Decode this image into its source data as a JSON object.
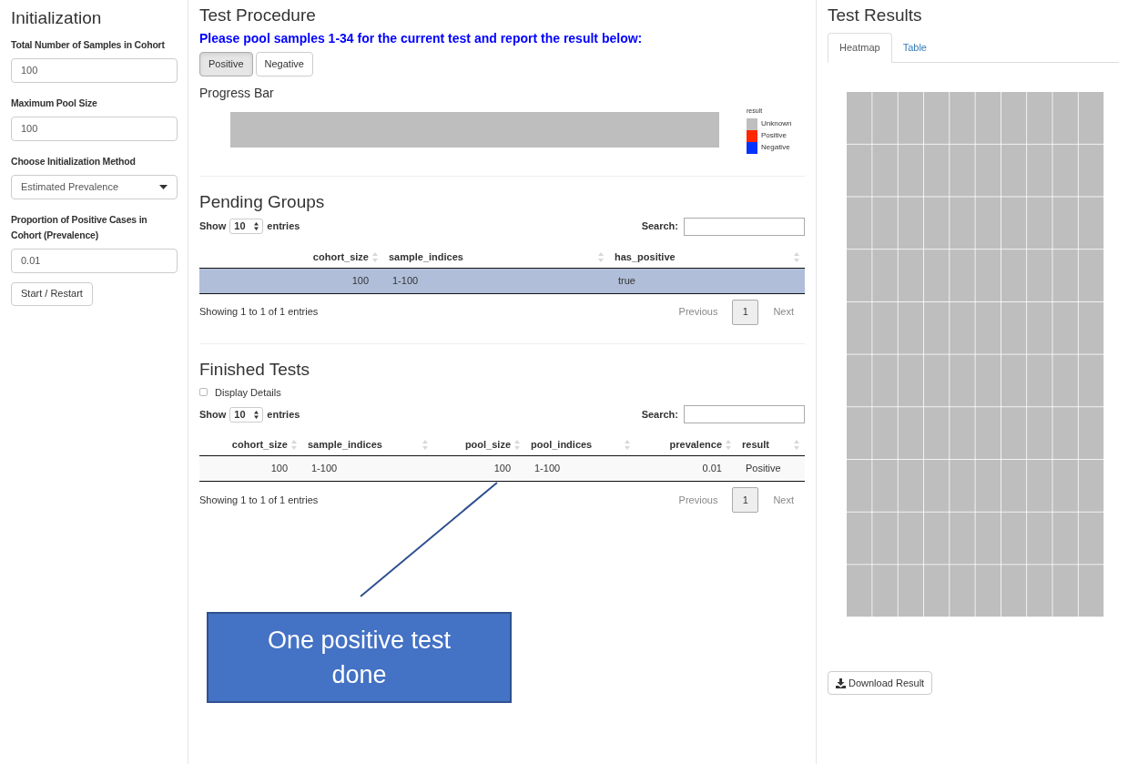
{
  "init": {
    "title": "Initialization",
    "fields": [
      {
        "kind": "input",
        "label": "Total Number of Samples in Cohort",
        "value": "100"
      },
      {
        "kind": "input",
        "label": "Maximum Pool Size",
        "value": "100"
      },
      {
        "kind": "select",
        "label": "Choose Initialization Method",
        "value": "Estimated Prevalence"
      },
      {
        "kind": "input",
        "label": "Proportion of Positive Cases in Cohort (Prevalence)",
        "value": "0.01"
      }
    ],
    "button": "Start / Restart"
  },
  "procedure": {
    "title": "Test Procedure",
    "instruction": "Please pool samples 1-34 for the current test and report the result below:",
    "buttons": [
      {
        "label": "Positive",
        "selected": true
      },
      {
        "label": "Negative",
        "selected": false
      }
    ],
    "progress_title": "Progress Bar",
    "progress": {
      "level": 1
    },
    "legend": {
      "title": "result",
      "items": [
        {
          "label": "Unknown",
          "color": "#bebebe"
        },
        {
          "label": "Positive",
          "color": "#ff2600"
        },
        {
          "label": "Negative",
          "color": "#0433ff"
        }
      ]
    }
  },
  "tables": [
    {
      "title": "Pending Groups",
      "show": "Show",
      "length": "10",
      "entries": "entries",
      "search": "Search:",
      "columns": [
        {
          "label": "cohort_size"
        },
        {
          "label": "sample_indices"
        },
        {
          "label": "has_positive"
        }
      ],
      "rows": [
        {
          "selected": true,
          "cells": [
            "100",
            "1-100",
            "true"
          ]
        }
      ],
      "info": "Showing 1 to 1 of 1 entries",
      "previous": "Previous",
      "pages": [
        {
          "label": "1",
          "selected": true
        }
      ],
      "next": "Next"
    },
    {
      "title": "Finished Tests",
      "checkbox": {
        "label": "Display Details",
        "checked": false
      },
      "show": "Show",
      "length": "10",
      "entries": "entries",
      "search": "Search:",
      "columns": [
        {
          "label": "cohort_size"
        },
        {
          "label": "sample_indices"
        },
        {
          "label": "pool_size"
        },
        {
          "label": "pool_indices"
        },
        {
          "label": "prevalence"
        },
        {
          "label": "result"
        }
      ],
      "rows": [
        {
          "selected": false,
          "cells": [
            "100",
            "1-100",
            "100",
            "1-100",
            "0.01",
            "Positive"
          ]
        }
      ],
      "info": "Showing 1 to 1 of 1 entries",
      "previous": "Previous",
      "pages": [
        {
          "label": "1",
          "selected": true
        }
      ],
      "next": "Next"
    }
  ],
  "results": {
    "title": "Test Results",
    "tabs": [
      {
        "label": "Heatmap",
        "selected": true
      },
      {
        "label": "Table",
        "selected": false
      }
    ],
    "button": "Download Result"
  },
  "callout": {
    "text": "One positive test done"
  }
}
